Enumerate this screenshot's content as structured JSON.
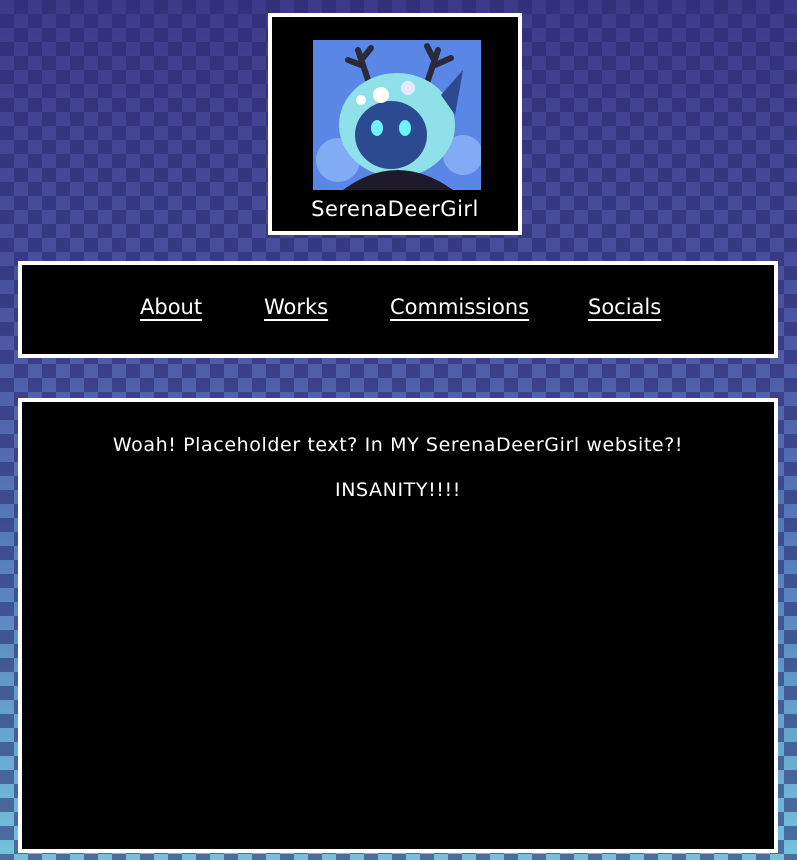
{
  "site": {
    "name": "SerenaDeerGirl"
  },
  "nav": {
    "items": [
      "About",
      "Works",
      "Commissions",
      "Socials"
    ]
  },
  "content": {
    "line1": "Woah! Placeholder text? In MY SerenaDeerGirl website?!",
    "line2": "INSANITY!!!!"
  },
  "colors": {
    "panel": "#000000",
    "border": "#ffffff",
    "text": "#ffffff",
    "background_top": "#3d3a8a",
    "background_bottom": "#74c2dc"
  }
}
